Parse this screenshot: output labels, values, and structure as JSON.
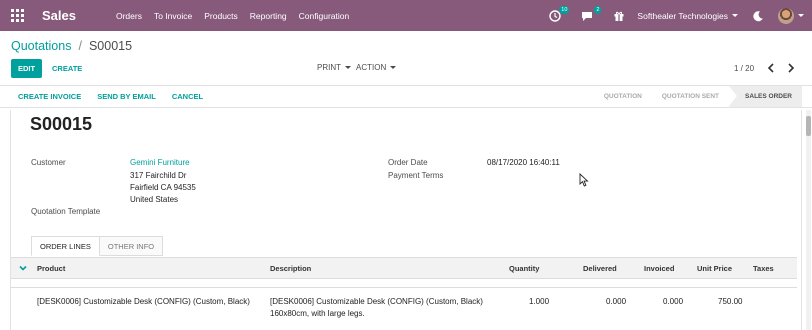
{
  "topbar": {
    "app_name": "Sales",
    "menu": [
      "Orders",
      "To Invoice",
      "Products",
      "Reporting",
      "Configuration"
    ],
    "activity_count": "10",
    "message_count": "2",
    "company": "Softhealer Technologies",
    "bg_color": "#875a7b"
  },
  "breadcrumb": {
    "parent": "Quotations",
    "separator": "/",
    "current": "S00015"
  },
  "actions": {
    "edit": "EDIT",
    "create": "CREATE",
    "print": "PRINT",
    "action": "ACTION"
  },
  "pager": {
    "text": "1 / 20"
  },
  "statusbar": {
    "buttons": [
      "CREATE INVOICE",
      "SEND BY EMAIL",
      "CANCEL"
    ],
    "stages": [
      "QUOTATION",
      "QUOTATION SENT",
      "SALES ORDER"
    ],
    "active_stage": "SALES ORDER"
  },
  "record": {
    "name": "S00015",
    "customer_label": "Customer",
    "customer_name": "Gemini Furniture",
    "address_line1": "317 Fairchild Dr",
    "address_line2": "Fairfield CA 94535",
    "address_line3": "United States",
    "order_date_label": "Order Date",
    "order_date": "08/17/2020 16:40:11",
    "payment_terms_label": "Payment Terms",
    "quotation_template_label": "Quotation Template"
  },
  "tabs": [
    "ORDER LINES",
    "OTHER INFO"
  ],
  "table": {
    "columns": [
      "Product",
      "Description",
      "Quantity",
      "Delivered",
      "Invoiced",
      "Unit Price",
      "Taxes"
    ],
    "rows": [
      {
        "product": "[DESK0006] Customizable Desk (CONFIG) (Custom, Black)",
        "description_line1": "[DESK0006] Customizable Desk (CONFIG) (Custom, Black)",
        "description_line2": "160x80cm, with large legs.",
        "quantity": "1.000",
        "delivered": "0.000",
        "invoiced": "0.000",
        "unit_price": "750.00",
        "taxes": ""
      }
    ]
  },
  "colors": {
    "accent": "#00a09d",
    "brand": "#875a7b"
  }
}
